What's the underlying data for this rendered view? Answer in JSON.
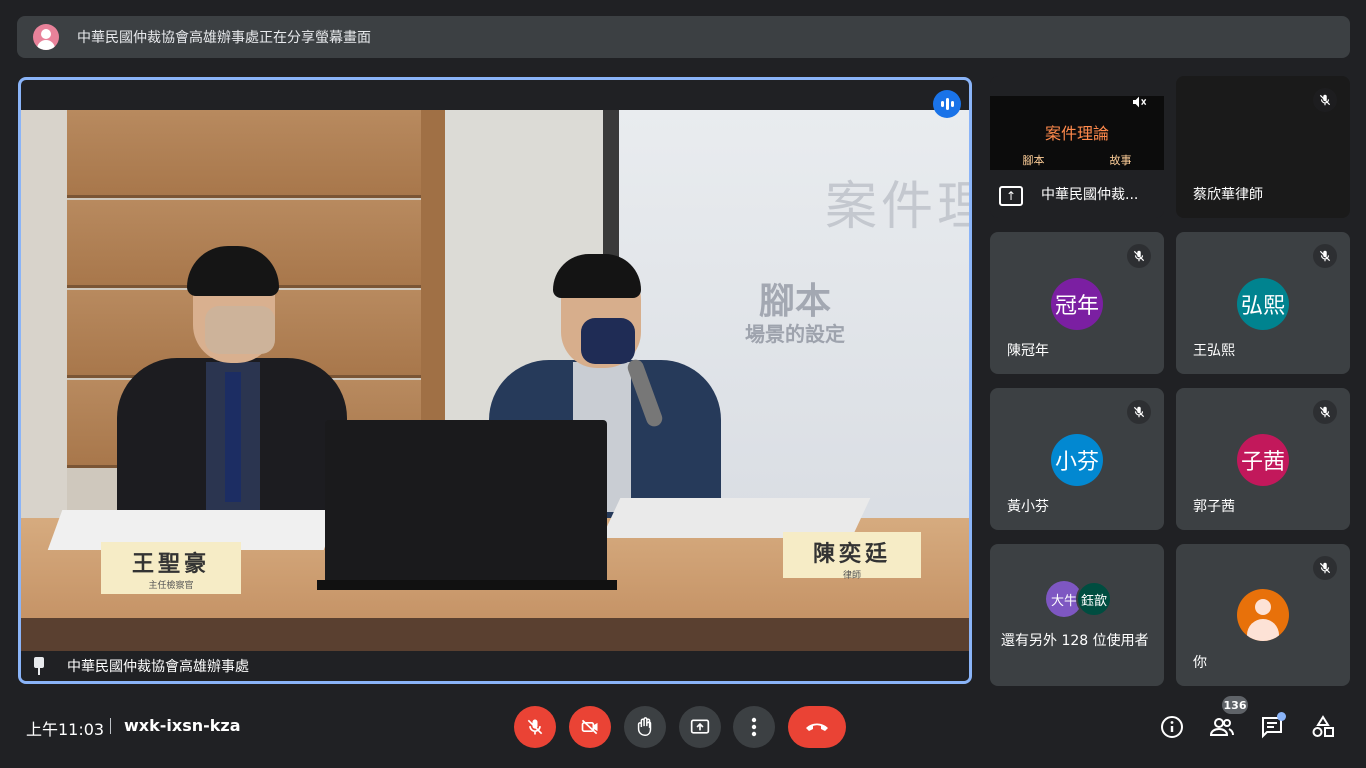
{
  "banner": {
    "text": "中華民國仲裁協會高雄辦事處正在分享螢幕畫面"
  },
  "main": {
    "presenter_name": "中華民國仲裁協會高雄辦事處",
    "projection": {
      "title": "案件理",
      "subtitle": "腳本",
      "subtitle2": "場景的設定"
    },
    "nameplates": [
      {
        "name": "王聖豪",
        "title": "主任檢察官"
      },
      {
        "name": "陳奕廷",
        "title": "律師"
      }
    ]
  },
  "tiles": {
    "presentation": {
      "label": "中華民國仲裁...",
      "screen_title": "案件理論",
      "screen_left": "腳本",
      "screen_right": "故事",
      "icon": "present-to-all-icon"
    },
    "cai": {
      "label": "蔡欣華律師"
    },
    "chen": {
      "label": "陳冠年",
      "initials": "冠年",
      "color": "#7b1fa2"
    },
    "wang": {
      "label": "王弘熙",
      "initials": "弘熙",
      "color": "#00838f"
    },
    "huang": {
      "label": "黃小芬",
      "initials": "小芬",
      "color": "#0288d1"
    },
    "guo": {
      "label": "郭子茜",
      "initials": "子茜",
      "color": "#c2185b"
    },
    "more": {
      "text": "還有另外 128 位使用者",
      "av1": "大牛",
      "av1_color": "#7e57c2",
      "av2": "鈺歆",
      "av2_color": "#004d40"
    },
    "you": {
      "label": "你",
      "color": "#e8710a"
    }
  },
  "bottom": {
    "time": "上午11:03",
    "meeting_code": "wxk-ixsn-kza",
    "participants_count": "136",
    "controls": [
      "mic-off-icon",
      "camera-off-icon",
      "raise-hand-icon",
      "present-icon",
      "more-options-icon",
      "hang-up-icon"
    ],
    "right_icons": [
      "info-icon",
      "people-icon",
      "chat-icon",
      "activities-icon"
    ]
  },
  "colors": {
    "accent": "#8ab4f8",
    "danger": "#ea4335",
    "speaking": "#1a73e8"
  }
}
